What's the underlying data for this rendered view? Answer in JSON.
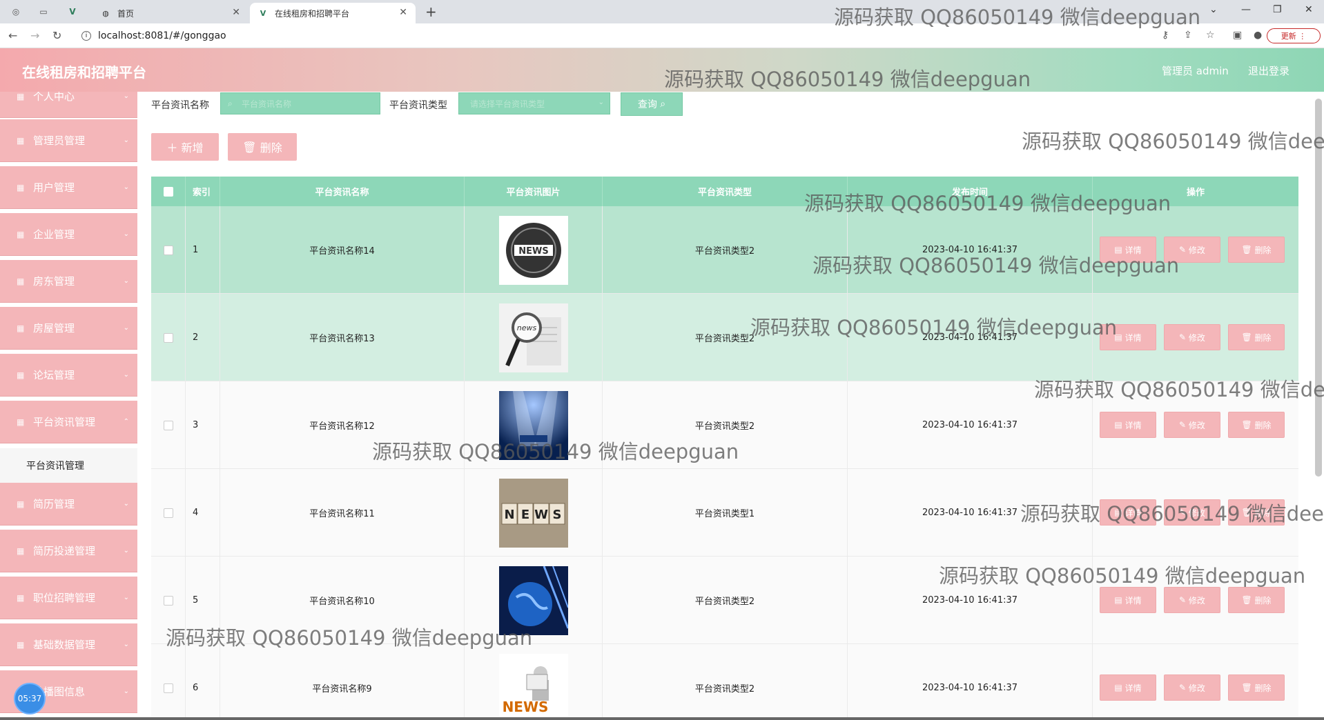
{
  "browser": {
    "tabs": [
      {
        "label": "首页",
        "active": false
      },
      {
        "label": "在线租房和招聘平台",
        "active": true
      }
    ],
    "url": "localhost:8081/#/gonggao",
    "update_label": "更新"
  },
  "header": {
    "title": "在线租房和招聘平台",
    "admin": "管理员 admin",
    "logout": "退出登录"
  },
  "sidebar": {
    "items": [
      {
        "label": "个人中心"
      },
      {
        "label": "管理员管理"
      },
      {
        "label": "用户管理"
      },
      {
        "label": "企业管理"
      },
      {
        "label": "房东管理"
      },
      {
        "label": "房屋管理"
      },
      {
        "label": "论坛管理"
      },
      {
        "label": "平台资讯管理"
      }
    ],
    "submenu": {
      "label": "平台资讯管理"
    },
    "items_after": [
      {
        "label": "简历管理"
      },
      {
        "label": "简历投递管理"
      },
      {
        "label": "职位招聘管理"
      },
      {
        "label": "基础数据管理"
      },
      {
        "label": "轮播图信息"
      }
    ]
  },
  "clock": "05:37",
  "search": {
    "name_label": "平台资讯名称",
    "name_placeholder": "平台资讯名称",
    "type_label": "平台资讯类型",
    "type_placeholder": "请选择平台资讯类型",
    "query_label": "查询"
  },
  "actions": {
    "add_label": "新增",
    "delete_label": "删除"
  },
  "table": {
    "headers": [
      "索引",
      "平台资讯名称",
      "平台资讯图片",
      "平台资讯类型",
      "发布时间",
      "操作"
    ],
    "rows": [
      {
        "index": "1",
        "name": "平台资讯名称14",
        "image": "news-globe",
        "type": "平台资讯类型2",
        "time": "2023-04-10 16:41:37"
      },
      {
        "index": "2",
        "name": "平台资讯名称13",
        "image": "news-magnifier",
        "type": "平台资讯类型2",
        "time": "2023-04-10 16:41:37"
      },
      {
        "index": "3",
        "name": "平台资讯名称12",
        "image": "news-spotlight",
        "type": "平台资讯类型2",
        "time": "2023-04-10 16:41:37"
      },
      {
        "index": "4",
        "name": "平台资讯名称11",
        "image": "news-blocks",
        "type": "平台资讯类型1",
        "time": "2023-04-10 16:41:37"
      },
      {
        "index": "5",
        "name": "平台资讯名称10",
        "image": "news-earth",
        "type": "平台资讯类型2",
        "time": "2023-04-10 16:41:37"
      },
      {
        "index": "6",
        "name": "平台资讯名称9",
        "image": "news-reader",
        "type": "平台资讯类型2",
        "time": "2023-04-10 16:41:37"
      }
    ],
    "op_labels": {
      "detail": "详情",
      "edit": "修改",
      "delete": "删除"
    }
  },
  "watermark": "源码获取 QQ86050149 微信deepguan",
  "colors": {
    "pink": "#f4b6b9",
    "green": "#8dd7b8",
    "row_highlight": "#b7e4cf"
  }
}
